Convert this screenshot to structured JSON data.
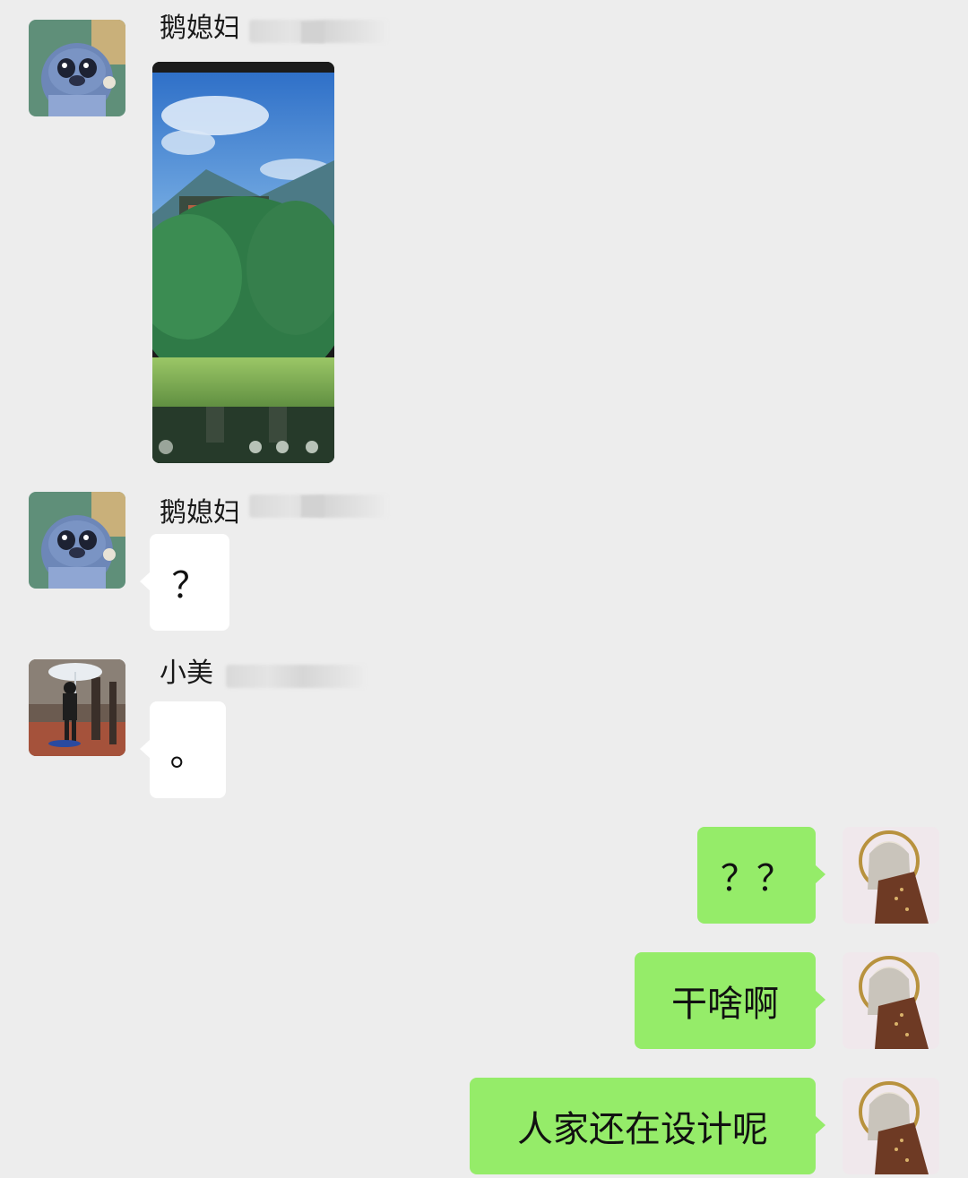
{
  "chat": {
    "messages": [
      {
        "direction": "incoming",
        "sender": "鹅媳妇",
        "type": "image",
        "image_description": "screenshot-thumbnail"
      },
      {
        "direction": "incoming",
        "sender": "鹅媳妇",
        "type": "text",
        "text": "？"
      },
      {
        "direction": "incoming",
        "sender": "小美",
        "type": "text",
        "text": "。"
      },
      {
        "direction": "outgoing",
        "type": "text",
        "text": "？？"
      },
      {
        "direction": "outgoing",
        "type": "text",
        "text": "干啥啊"
      },
      {
        "direction": "outgoing",
        "type": "text",
        "text": "人家还在设计呢"
      }
    ]
  },
  "colors": {
    "background": "#ededed",
    "incoming_bubble": "#ffffff",
    "outgoing_bubble": "#95ec69"
  },
  "icons": {
    "avatar_ehfu": "stitch-avatar-icon",
    "avatar_xiaomei": "person-umbrella-avatar-icon",
    "avatar_self": "illustrated-figure-avatar-icon"
  }
}
